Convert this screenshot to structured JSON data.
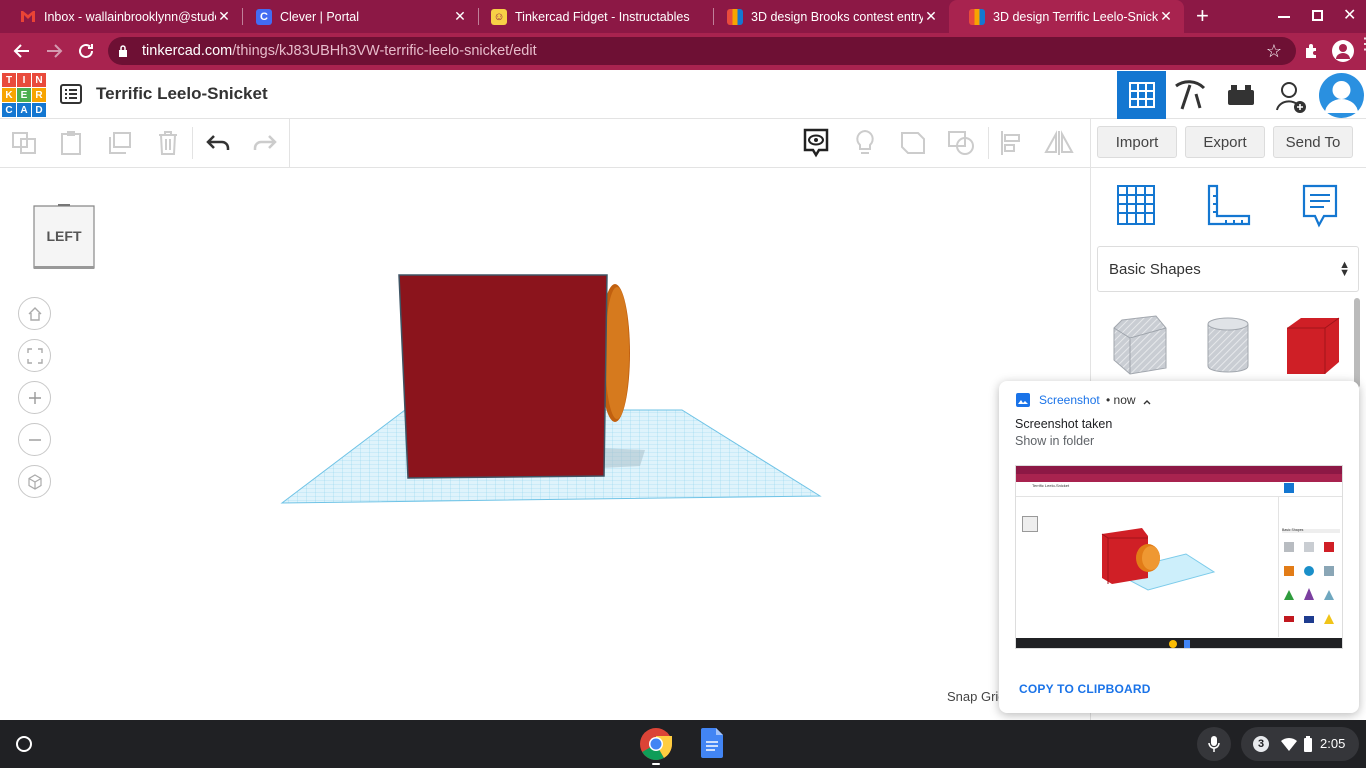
{
  "browser": {
    "tabs": [
      {
        "title": "Inbox - wallainbrooklynn@stude",
        "favicon": "gmail-icon",
        "active": false
      },
      {
        "title": "Clever | Portal",
        "favicon": "clever-icon",
        "active": false
      },
      {
        "title": "Tinkercad Fidget - Instructables",
        "favicon": "instructables-icon",
        "active": false
      },
      {
        "title": "3D design Brooks contest entry",
        "favicon": "tinkercad-icon",
        "active": false
      },
      {
        "title": "3D design Terrific Leelo-Snicket",
        "favicon": "tinkercad-icon",
        "active": true
      }
    ],
    "new_tab": "+",
    "url_host": "tinkercad.com",
    "url_path": "/things/kJ83UBHh3VW-terrific-leelo-snicket/edit"
  },
  "app": {
    "logo_letters": [
      "T",
      "I",
      "N",
      "K",
      "E",
      "R",
      "C",
      "A",
      "D"
    ],
    "design_title": "Terrific Leelo-Snicket",
    "toolbar_buttons": {
      "import": "Import",
      "export": "Export",
      "send_to": "Send To"
    },
    "view_cube_label": "LEFT",
    "shapes_dropdown": "Basic Shapes",
    "snap_grid_label": "Snap Grid"
  },
  "notification": {
    "app_name": "Screenshot",
    "time": "now",
    "title": "Screenshot taken",
    "subtitle": "Show in folder",
    "action": "COPY TO CLIPBOARD",
    "thumbnail_title": "Terrific Leelo-Snicket",
    "thumbnail_dropdown": "Basic Shapes"
  },
  "shelf": {
    "notification_count": "3",
    "time": "2:05"
  },
  "colors": {
    "tab_strip": "#8c1845",
    "toolbar": "#a8234f",
    "accent_blue": "#1477d1",
    "box_red": "#8b141c",
    "cylinder_orange": "#c1600f",
    "grid_blue": "#8fd3ee"
  }
}
